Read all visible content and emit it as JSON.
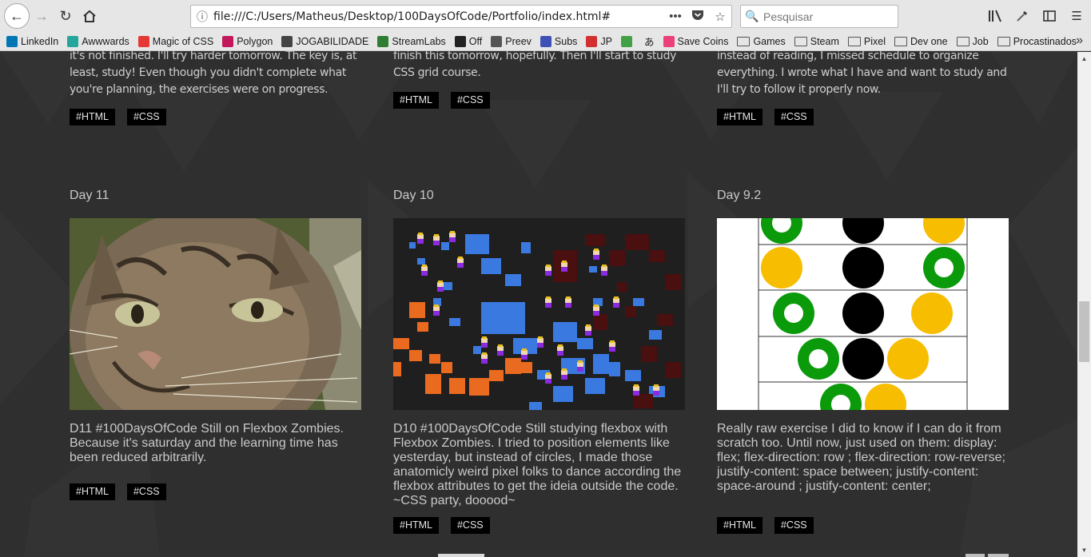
{
  "browser": {
    "url": "file:///C:/Users/Matheus/Desktop/100DaysOfCode/Portfolio/index.html#",
    "search_placeholder": "Pesquisar",
    "page_actions_icon": "•••"
  },
  "bookmarks": [
    {
      "label": "LinkedIn",
      "icon": "linkedin-icon",
      "color": "#0077b5"
    },
    {
      "label": "Awwwards",
      "icon": "awwwards-icon",
      "color": "#26a69a"
    },
    {
      "label": "Magic of CSS",
      "icon": "magic-css-icon",
      "color": "#e53935"
    },
    {
      "label": "Polygon",
      "icon": "polygon-icon",
      "color": "#c2185b"
    },
    {
      "label": "JOGABILIDADE",
      "icon": "jogabilidade-icon",
      "color": "#444444"
    },
    {
      "label": "StreamLabs",
      "icon": "streamlabs-icon",
      "color": "#2e7d32"
    },
    {
      "label": "Off",
      "icon": "power-icon",
      "color": "#222222"
    },
    {
      "label": "Preev",
      "icon": "bitcoin-icon",
      "color": "#555555"
    },
    {
      "label": "Subs",
      "icon": "subs-icon",
      "color": "#3f51b5"
    },
    {
      "label": "JP",
      "icon": "jp-icon",
      "color": "#d32f2f"
    },
    {
      "label": "",
      "icon": "l-icon",
      "color": "#43a047"
    },
    {
      "label": "あ",
      "icon": "",
      "color": ""
    },
    {
      "label": "Save Coins",
      "icon": "flower-icon",
      "color": "#ec407a"
    },
    {
      "label": "Games",
      "icon": "folder-icon",
      "color": ""
    },
    {
      "label": "Steam",
      "icon": "folder-icon",
      "color": ""
    },
    {
      "label": "Pixel",
      "icon": "folder-icon",
      "color": ""
    },
    {
      "label": "Dev one",
      "icon": "folder-icon",
      "color": ""
    },
    {
      "label": "Job",
      "icon": "folder-icon",
      "color": ""
    },
    {
      "label": "Procastinados",
      "icon": "folder-icon",
      "color": ""
    }
  ],
  "posts_top": [
    {
      "desc": "it's not finished. I'll try harder tomorrow. The key is, at least, study! Even though you didn't complete what you're planning, the exercises were on progress.",
      "tags": [
        "#HTML",
        "#CSS"
      ]
    },
    {
      "desc": "finish this tomorrow, hopefully. Then I'll start to study CSS grid course.",
      "tags": [
        "#HTML",
        "#CSS"
      ]
    },
    {
      "desc": "instead of reading, I missed schedule to organize everything. I wrote what I have and want to study and I'll try to follow it properly now.",
      "tags": [
        "#HTML",
        "#CSS"
      ]
    }
  ],
  "posts": [
    {
      "title": "Day 11",
      "image": "cat-photo",
      "desc": "D11 #100DaysOfCode Still on Flexbox Zombies. Because it's saturday and the learning time has been reduced arbitrarily.",
      "tags": [
        "#HTML",
        "#CSS"
      ]
    },
    {
      "title": "Day 10",
      "image": "pixel-folks-screenshot",
      "desc": "D10 #100DaysOfCode Still studying flexbox with Flexbox Zombies. I tried to position elements like yesterday, but instead of circles, I made those anatomicly weird pixel folks to dance according the flexbox attributes to get the ideia outside the code. ~CSS party, dooood~",
      "tags": [
        "#HTML",
        "#CSS"
      ]
    },
    {
      "title": "Day 9.2",
      "image": "flexbox-circles-exercise",
      "desc": "Really raw exercise I did to know if I can do it from scratch too. Until now, just used on them: display: flex; flex-direction: row ; flex-direction: row-reverse; justify-content: space between; justify-content: space-around ; justify-content: center;",
      "tags": [
        "#HTML",
        "#CSS"
      ]
    }
  ],
  "colors": {
    "page_bg": "#2f2f2f",
    "tag_bg": "#000000",
    "circle_green": "#0a9a0a",
    "circle_yellow": "#f7bd00"
  }
}
